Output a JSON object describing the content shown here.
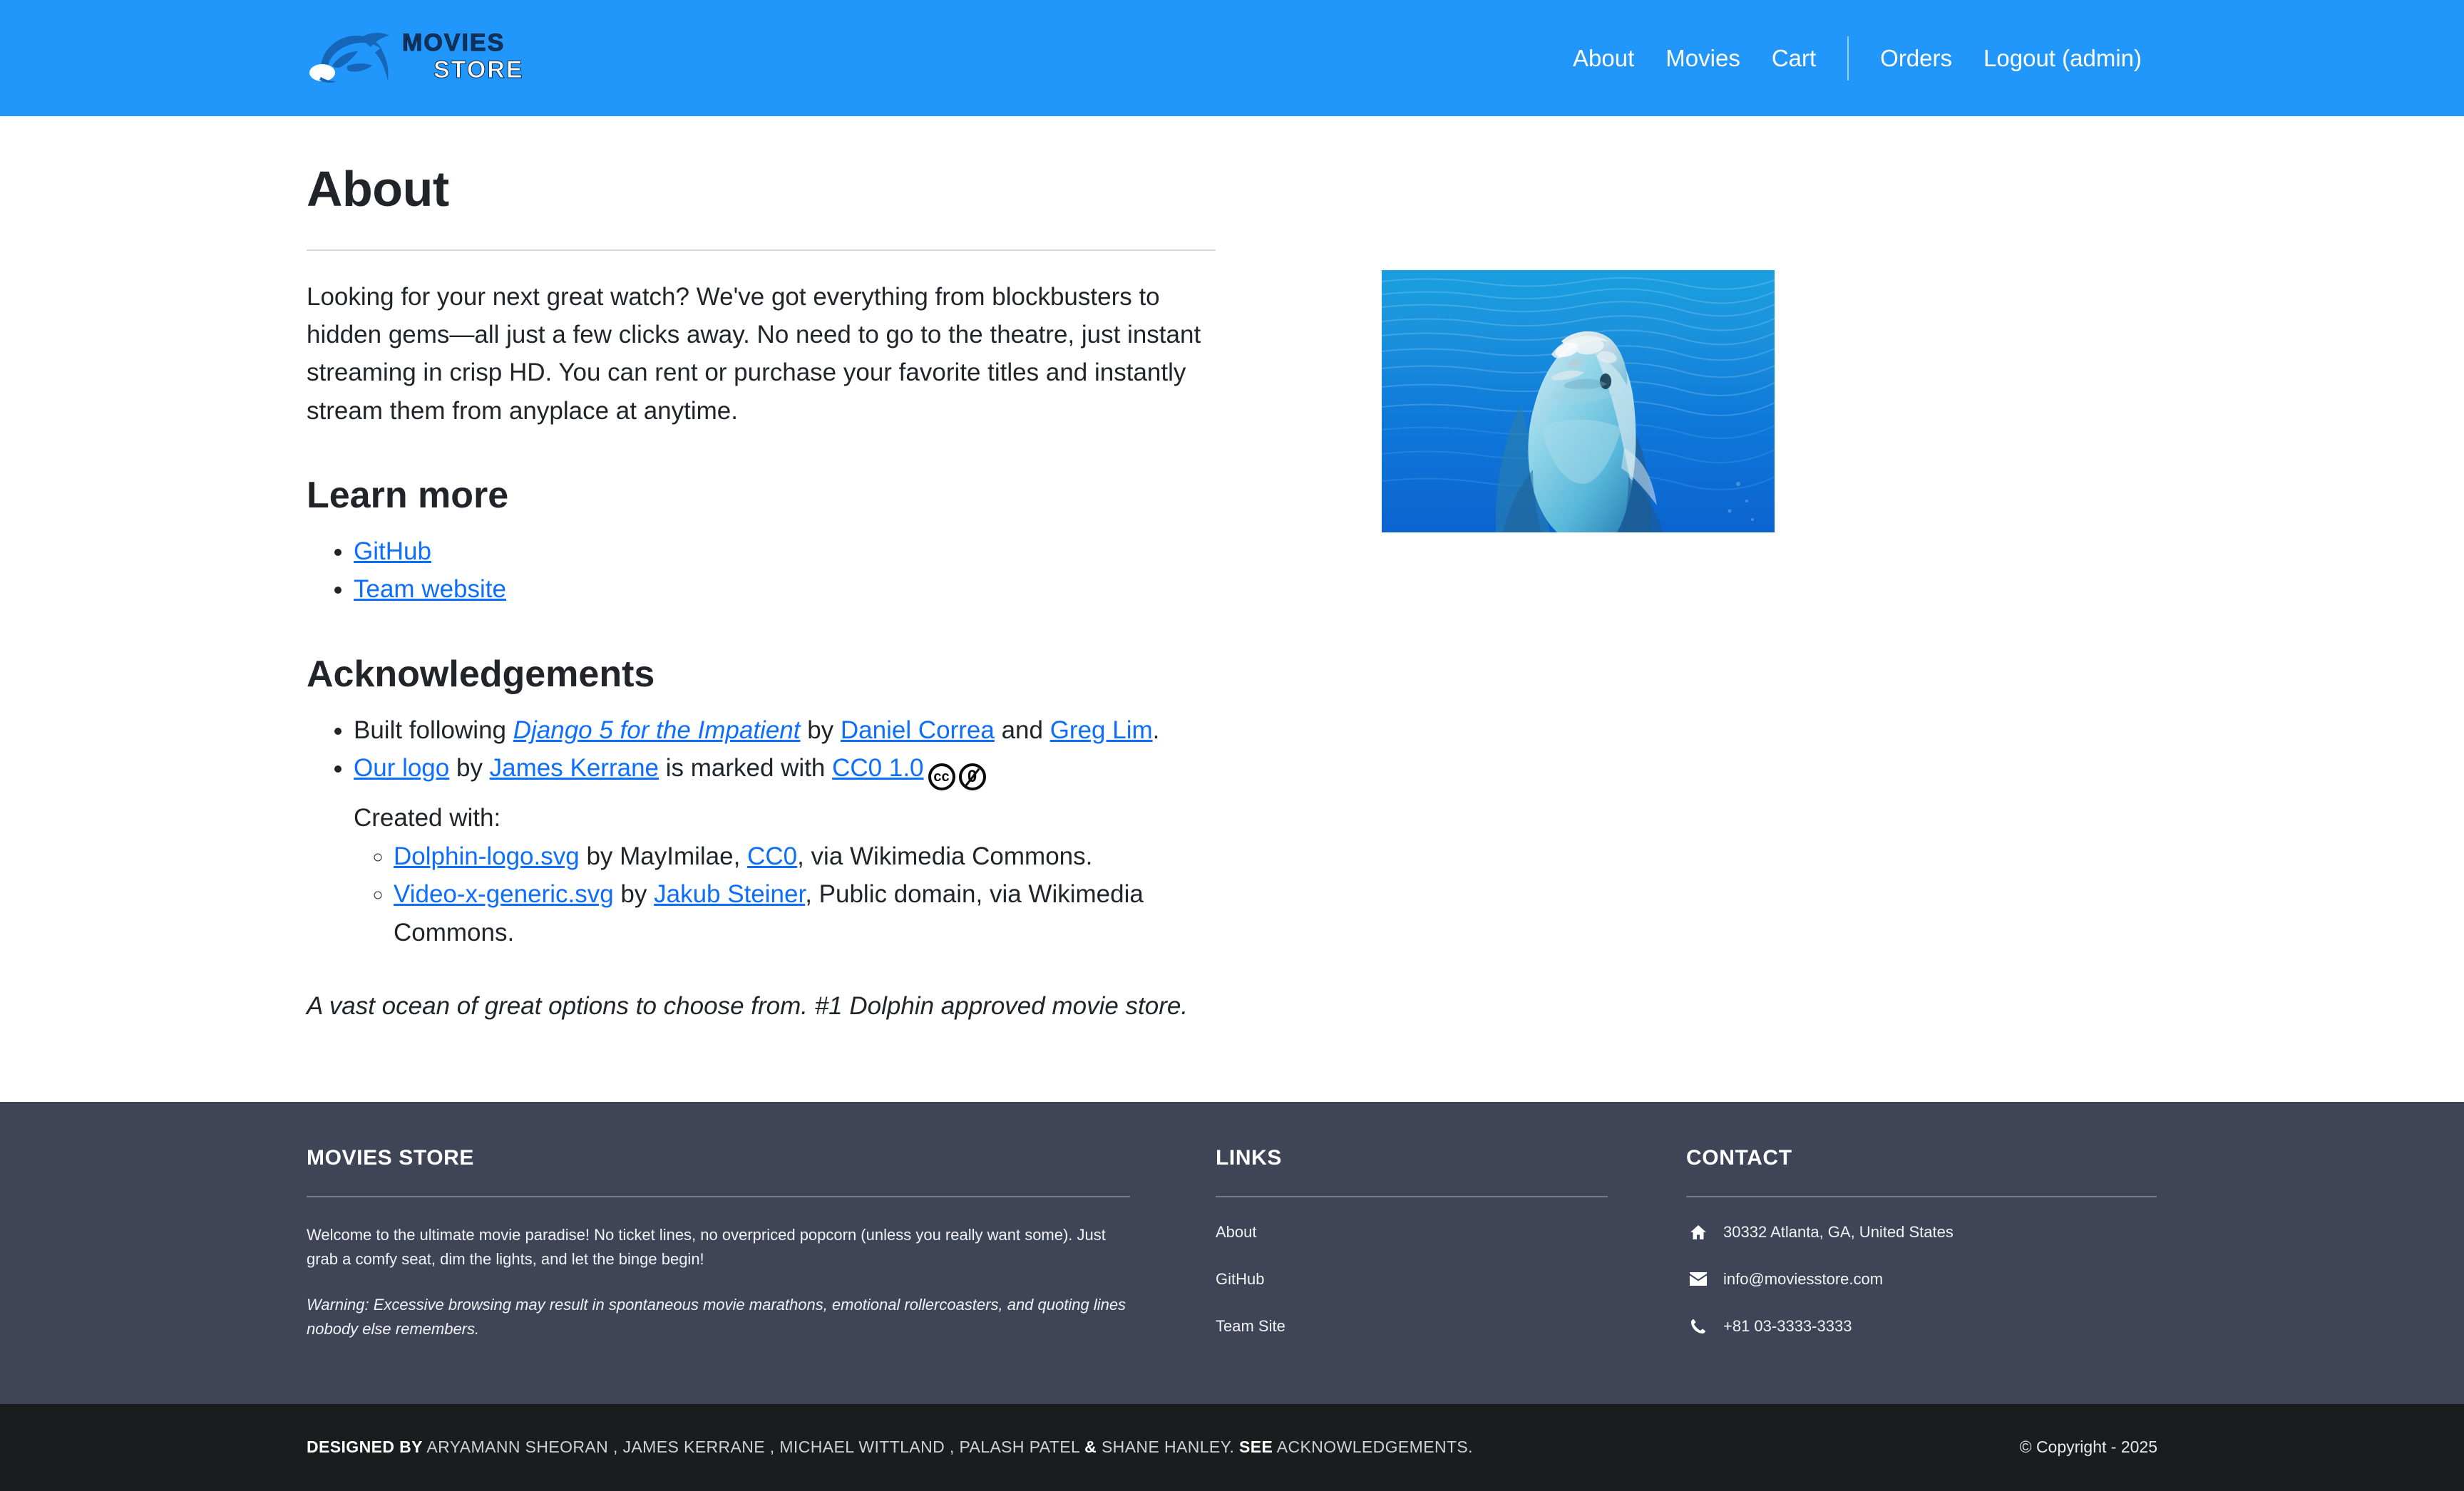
{
  "brand": {
    "line1": "MOVIES",
    "line2": "STORE",
    "logo_icon": "dolphin-logo-icon"
  },
  "nav": {
    "primary": [
      {
        "label": "About"
      },
      {
        "label": "Movies"
      },
      {
        "label": "Cart"
      }
    ],
    "secondary": [
      {
        "label": "Orders"
      },
      {
        "label": "Logout (admin)"
      }
    ]
  },
  "main": {
    "page_title": "About",
    "intro": "Looking for your next great watch? We've got everything from blockbusters to hidden gems—all just a few clicks away. No need to go to the theatre, just instant streaming in crisp HD. You can rent or purchase your favorite titles and instantly stream them from anyplace at anytime.",
    "learn_more_title": "Learn more",
    "learn_more_links": [
      {
        "label": "GitHub"
      },
      {
        "label": "Team website"
      }
    ],
    "acknowledgements_title": "Acknowledgements",
    "ack": {
      "built_prefix": "Built following ",
      "book_title": "Django 5 for the Impatient",
      "by_1": " by ",
      "author_1": "Daniel Correa",
      "and": " and ",
      "author_2": "Greg Lim",
      "period": ".",
      "logo_link": "Our logo",
      "by_2": " by ",
      "logo_author": "James Kerrane",
      "marked_with": " is marked with ",
      "license": "CC0 1.0",
      "cc_icon_1": "cc-icon",
      "cc_icon_2": "cc-zero-icon",
      "created_with": "Created with:",
      "sub_items": [
        {
          "link": "Dolphin-logo.svg",
          "by": " by MayImilae, ",
          "license": "CC0",
          "tail": ", via Wikimedia Commons."
        },
        {
          "link": "Video-x-generic.svg",
          "by": " by ",
          "license": "Jakub Steiner",
          "tail": ", Public domain, via Wikimedia Commons."
        }
      ]
    },
    "tagline": "A vast ocean of great options to choose from. #1 Dolphin approved movie store.",
    "hero_image_alt": "dolphin-underwater-photo"
  },
  "footer": {
    "about": {
      "title": "MOVIES STORE",
      "body": "Welcome to the ultimate movie paradise! No ticket lines, no overpriced popcorn (unless you really want some). Just grab a comfy seat, dim the lights, and let the binge begin!",
      "warning": "Warning: Excessive browsing may result in spontaneous movie marathons, emotional rollercoasters, and quoting lines nobody else remembers."
    },
    "links": {
      "title": "LINKS",
      "items": [
        {
          "label": "About"
        },
        {
          "label": "GitHub"
        },
        {
          "label": "Team Site"
        }
      ]
    },
    "contact": {
      "title": "CONTACT",
      "items": [
        {
          "icon": "home-icon",
          "value": "30332 Atlanta, GA, United States"
        },
        {
          "icon": "envelope-icon",
          "value": "info@moviesstore.com"
        },
        {
          "icon": "phone-icon",
          "value": "+81 03-3333-3333"
        }
      ]
    }
  },
  "subfooter": {
    "designed_by_label": "DESIGNED BY",
    "designers": "ARYAMANN SHEORAN , JAMES KERRANE , MICHAEL WITTLAND , PALASH PATEL",
    "ampersand": "&",
    "last_designer": "SHANE HANLEY.",
    "see_label": "SEE",
    "ack_label": "ACKNOWLEDGEMENTS.",
    "copyright": "© Copyright - 2025"
  },
  "colors": {
    "brand_blue": "#2196fb",
    "link_blue": "#0d6efd",
    "footer_bg": "#3f4457",
    "subfooter_bg": "#1b1c1e"
  }
}
